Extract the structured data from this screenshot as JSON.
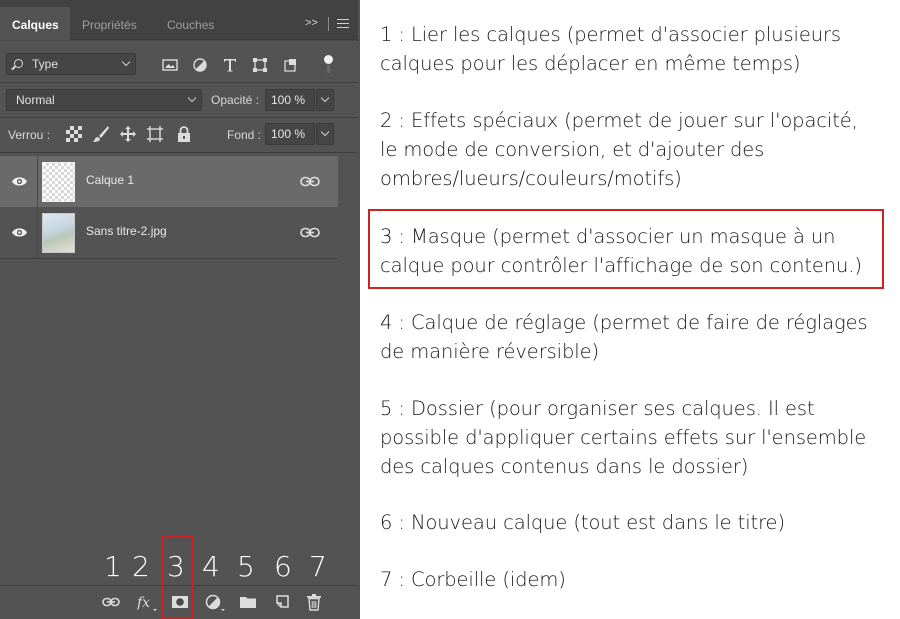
{
  "panel": {
    "tabs": [
      "Calques",
      "Propriétés",
      "Couches"
    ],
    "collapse_label": ">>",
    "filter": {
      "value": "Type"
    },
    "blend_mode": {
      "value": "Normal"
    },
    "opacity": {
      "label": "Opacité :",
      "value": "100 %"
    },
    "lock": {
      "label": "Verrou :"
    },
    "fill": {
      "label": "Fond :",
      "value": "100 %"
    },
    "layers": [
      {
        "name": "Calque 1",
        "visible": true,
        "selected": true
      },
      {
        "name": "Sans titre-2.jpg",
        "visible": true,
        "selected": false
      }
    ],
    "bottom_numbers": [
      "1",
      "2",
      "3",
      "4",
      "5",
      "6",
      "7"
    ],
    "bottom_icons": [
      "link-layers-icon",
      "fx-icon",
      "mask-icon",
      "adjustment-icon",
      "folder-icon",
      "new-layer-icon",
      "trash-icon"
    ],
    "highlight_color": "#cc2222"
  },
  "descriptions": [
    {
      "lines": [
        "1 : Lier les calques (permet d'associer plusieurs",
        "calques pour les déplacer en même temps)"
      ]
    },
    {
      "lines": [
        "2 : Effets spéciaux (permet de jouer sur l'opacité,",
        "le mode de conversion, et d'ajouter des",
        "ombres/lueurs/couleurs/motifs)"
      ]
    },
    {
      "lines": [
        "3 : Masque (permet d'associer un masque à un",
        "calque pour contrôler l'affichage de son contenu.)"
      ],
      "highlighted": true
    },
    {
      "lines": [
        "4 : Calque de réglage (permet de faire de réglages",
        "de manière réversible)"
      ]
    },
    {
      "lines": [
        "5 : Dossier (pour organiser ses calques. Il est",
        "possible d'appliquer certains effets sur l'ensemble",
        "des calques contenus dans le dossier)"
      ]
    },
    {
      "lines": [
        "6 : Nouveau calque (tout est dans le titre)"
      ]
    },
    {
      "lines": [
        "7 : Corbeille (idem)"
      ]
    }
  ]
}
